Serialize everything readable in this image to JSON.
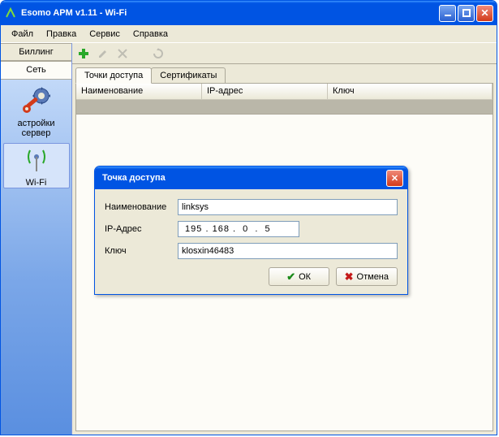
{
  "window": {
    "title": "Esomo APM v1.11 - Wi-Fi"
  },
  "menu": {
    "file": "Файл",
    "edit": "Правка",
    "service": "Сервис",
    "help": "Справка"
  },
  "sidebar": {
    "billing": "Биллинг",
    "network": "Сеть",
    "server_settings": "астройки сервер",
    "wifi": "Wi-Fi"
  },
  "tabs": {
    "access_points": "Точки доступа",
    "certificates": "Сертификаты"
  },
  "grid": {
    "col_name": "Наименование",
    "col_ip": "IP-адрес",
    "col_key": "Ключ"
  },
  "dialog": {
    "title": "Точка доступа",
    "label_name": "Наименование",
    "label_ip": "IP-Адрес",
    "label_key": "Ключ",
    "value_name": "linksys",
    "value_ip": " 195 . 168 .  0  .  5",
    "value_key": "klosxin46483",
    "btn_ok": "ОК",
    "btn_cancel": "Отмена"
  }
}
